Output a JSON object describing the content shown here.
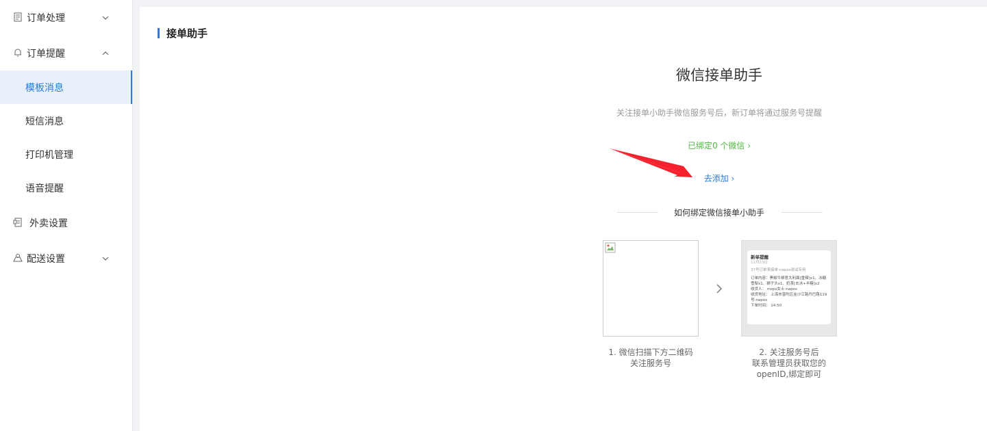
{
  "sidebar": {
    "groups": [
      {
        "label": "订单处理",
        "icon": "document-icon",
        "expanded": false
      },
      {
        "label": "订单提醒",
        "icon": "bell-icon",
        "expanded": true
      },
      {
        "label": "外卖设置",
        "icon": "delivery-settings-icon"
      },
      {
        "label": "配送设置",
        "icon": "map-icon",
        "expanded": false
      }
    ],
    "subitems": [
      {
        "label": "模板消息",
        "active": true
      },
      {
        "label": "短信消息",
        "active": false
      },
      {
        "label": "打印机管理",
        "active": false
      },
      {
        "label": "语音提醒",
        "active": false
      }
    ]
  },
  "main": {
    "section_title": "接单助手",
    "heading": "微信接单助手",
    "description": "关注接单小助手微信服务号后，新订单将通过服务号提醒",
    "bound_link": "已绑定0 个微信 ›",
    "add_link": "去添加 ›",
    "how_to_title": "如何绑定微信接单小助手",
    "step1_line1": "1. 微信扫描下方二维码",
    "step1_line2": "关注服务号",
    "step2_line1": "2. 关注服务号后",
    "step2_line2": "联系管理员获取您的",
    "step2_line3": "openID,绑定即可",
    "preview": {
      "title": "新单提醒",
      "date": "11月23日",
      "sub": "37号订单来接单-napos测试专用",
      "content_label": "订单内容：",
      "content": "黑椒牛柳意大利面[重辣]x1、冰糖雪梨x1、狮子头x1、奶茶[去冰+半糖]x2",
      "receiver": "收货人：   mzps女士-napos",
      "address": "收货地址：  上海市普陀区金沙江路丹巴路119号-napos",
      "time": "下单时间：  14:50"
    }
  },
  "colors": {
    "accent": "#2d7ad6",
    "success": "#52b545",
    "annotation_arrow": "#f5222d"
  }
}
